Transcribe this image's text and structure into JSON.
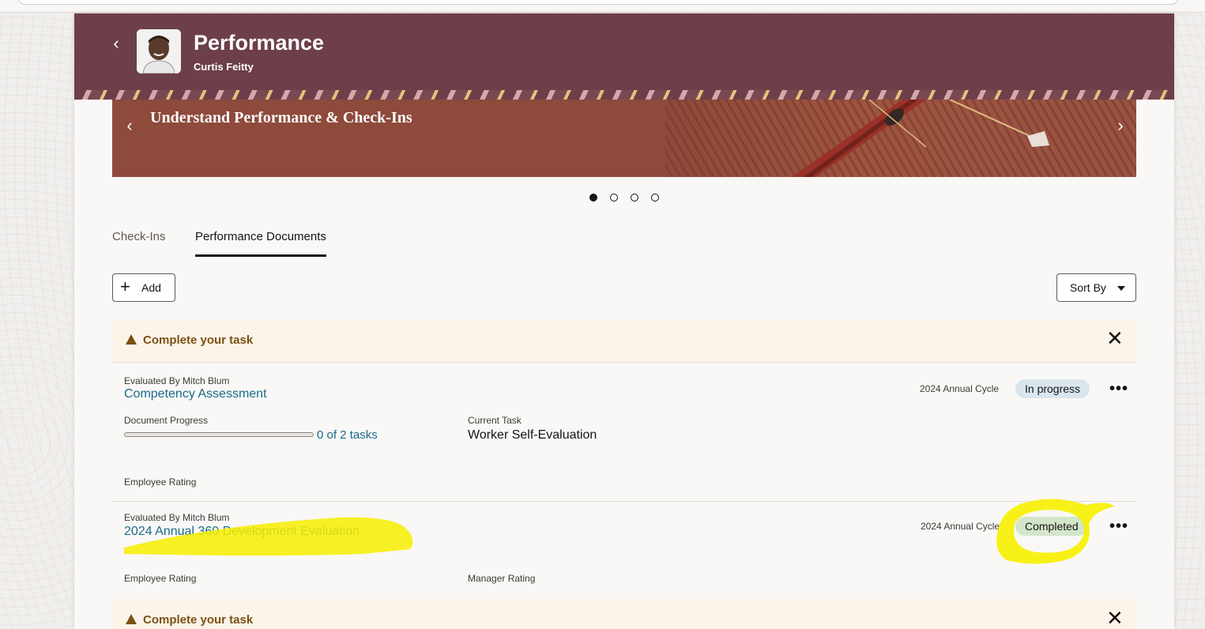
{
  "header": {
    "title": "Performance",
    "subtitle": "Curtis Feitty",
    "back_icon": "chevron-left-icon",
    "color": "#6d3f4a"
  },
  "banner": {
    "text": "Understand Performance & Check-Ins",
    "prev_icon": "chevron-left-icon",
    "next_icon": "chevron-right-icon",
    "slides_total": 4,
    "active_slide": 1
  },
  "tabs": [
    {
      "label": "Check-Ins",
      "active": false
    },
    {
      "label": "Performance Documents",
      "active": true
    }
  ],
  "toolbar": {
    "add_label": "Add",
    "sort_label": "Sort By"
  },
  "task_banner": {
    "text": "Complete your task",
    "icon": "warning-icon",
    "close_icon": "close-icon",
    "color": "#7a5114"
  },
  "documents": [
    {
      "evaluated_by": "Evaluated By Mitch Blum",
      "name": "Competency Assessment",
      "cycle": "2024 Annual Cycle",
      "status": "In progress",
      "progress_label": "Document Progress",
      "progress_value": "0 of 2 tasks",
      "progress_fraction": 0,
      "current_task_label": "Current Task",
      "current_task": "Worker Self-Evaluation",
      "employee_rating_label": "Employee Rating"
    },
    {
      "evaluated_by": "Evaluated By Mitch Blum",
      "name": "2024 Annual 360 Development Evaluation",
      "cycle": "2024 Annual Cycle",
      "status": "Completed",
      "employee_rating_label": "Employee Rating",
      "manager_rating_label": "Manager Rating"
    }
  ],
  "task_banner_2": {
    "text": "Complete your task"
  },
  "colors": {
    "link": "#1b6a8a",
    "in_progress_badge": "#d9e6ee",
    "completed_badge": "#d4e6c9",
    "highlighter": "#f7ef00"
  }
}
